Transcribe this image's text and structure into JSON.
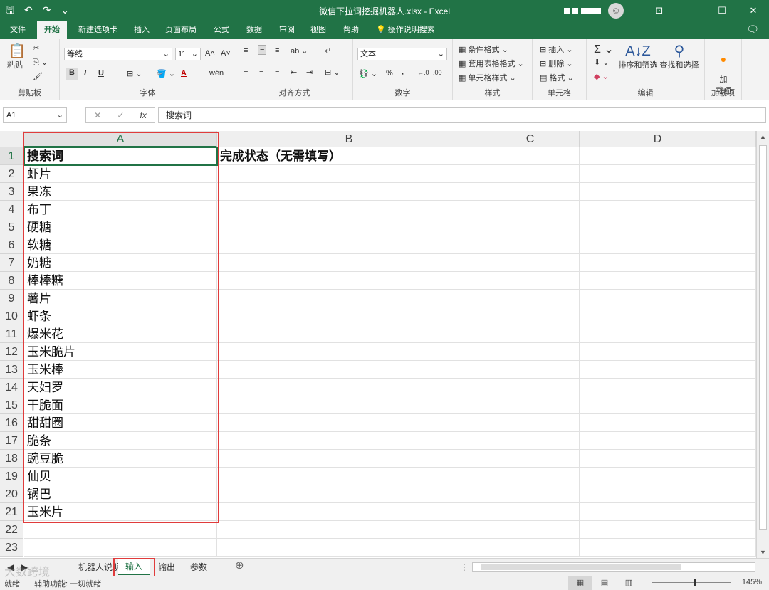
{
  "window": {
    "title": "微信下拉词挖掘机器人.xlsx  -  Excel",
    "minimize": "—",
    "maximize": "☐",
    "close": "✕",
    "ribbon_display": "⊡",
    "avatar": "☺"
  },
  "qat": {
    "save": "🖫",
    "undo": "↶",
    "redo": "↷",
    "more": "⌄"
  },
  "menu": {
    "tabs": [
      "文件",
      "开始",
      "新建选项卡",
      "插入",
      "页面布局",
      "公式",
      "数据",
      "审阅",
      "视图",
      "帮助"
    ],
    "search": "操作说明搜索",
    "active": "开始"
  },
  "ribbon": {
    "clipboard": {
      "label": "剪贴板",
      "paste": "粘贴"
    },
    "font": {
      "label": "字体",
      "name": "等线",
      "size": "11",
      "bold": "B",
      "italic": "I",
      "underline": "U",
      "grow": "A˄",
      "shrink": "A˅",
      "color": "A",
      "phonetic": "wén"
    },
    "alignment": {
      "label": "对齐方式"
    },
    "number": {
      "label": "数字",
      "format": "文本",
      "percent": "%",
      "comma": ","
    },
    "styles": {
      "label": "样式",
      "conditional": "条件格式 ⌄",
      "table": "套用表格格式 ⌄",
      "cell": "单元格样式 ⌄"
    },
    "cells": {
      "label": "单元格",
      "insert": "插入 ⌄",
      "delete": "删除 ⌄",
      "format": "格式 ⌄"
    },
    "editing": {
      "label": "编辑",
      "sort": "排序和筛选",
      "find": "查找和选择"
    },
    "addins": {
      "label": "加载项",
      "name": "加\n载项"
    }
  },
  "formula_bar": {
    "name_box": "A1",
    "content": "搜索词",
    "cancel": "✕",
    "enter": "✓",
    "fx": "fx"
  },
  "columns": [
    "A",
    "B",
    "C",
    "D"
  ],
  "rows": [
    "1",
    "2",
    "3",
    "4",
    "5",
    "6",
    "7",
    "8",
    "9",
    "10",
    "11",
    "12",
    "13",
    "14",
    "15",
    "16",
    "17",
    "18",
    "19",
    "20",
    "21",
    "22",
    "23"
  ],
  "cells": {
    "A1": "搜索词",
    "B1": "完成状态（无需填写）",
    "A": [
      "虾片",
      "果冻",
      "布丁",
      "硬糖",
      "软糖",
      "奶糖",
      "棒棒糖",
      "薯片",
      "虾条",
      "爆米花",
      "玉米脆片",
      "玉米棒",
      "天妇罗",
      "干脆面",
      "甜甜圈",
      "脆条",
      "豌豆脆",
      "仙贝",
      "锅巴",
      "玉米片"
    ]
  },
  "sheets": {
    "tabs": [
      "机器人说明",
      "输入",
      "输出",
      "参数"
    ],
    "active": "输入",
    "add": "⊕"
  },
  "status": {
    "ready": "就绪",
    "accessibility": "辅助功能: 一切就绪",
    "zoom": "145%"
  },
  "watermark": "大数跨境"
}
